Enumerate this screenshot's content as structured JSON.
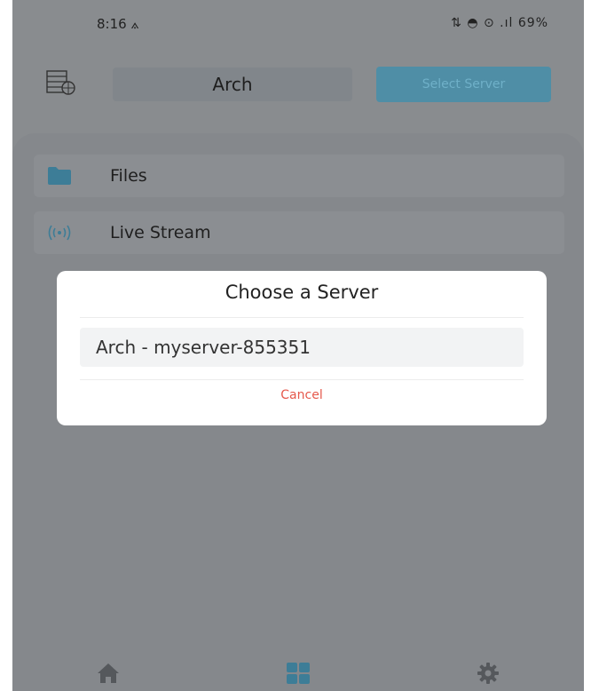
{
  "status_bar": {
    "time": "8:16",
    "right": "⚡↑ ▼ ⇄ .  ▮▮▮ 69%",
    "battery": "69%"
  },
  "header": {
    "server_name": "Arch",
    "select_server_label": "Select Server",
    "icon": "server-grid-icon"
  },
  "menu": {
    "items": [
      {
        "label": "Files",
        "icon": "folder-icon"
      },
      {
        "label": "Live Stream",
        "icon": "broadcast-icon"
      }
    ]
  },
  "dialog": {
    "title": "Choose a Server",
    "options": [
      {
        "label": "Arch - myserver-855351"
      }
    ],
    "cancel_label": "Cancel"
  },
  "bottom_nav": {
    "items": [
      {
        "icon": "home-icon"
      },
      {
        "icon": "grid-icon",
        "active": true
      },
      {
        "icon": "settings-icon"
      }
    ]
  },
  "colors": {
    "accent": "#4f8ea6",
    "cancel": "#e5584b",
    "overlay": "#898c8f"
  }
}
